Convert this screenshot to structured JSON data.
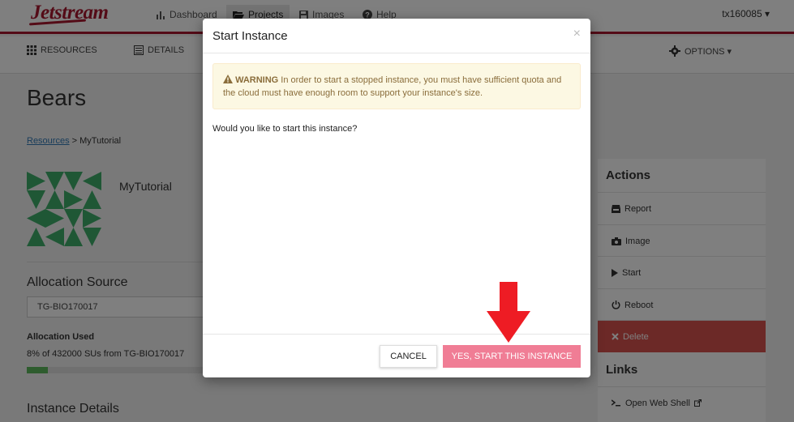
{
  "topnav": {
    "logo": "Jetstream",
    "items": [
      {
        "label": "Dashboard",
        "icon": "bar-chart-icon"
      },
      {
        "label": "Projects",
        "icon": "folder-open-icon"
      },
      {
        "label": "Images",
        "icon": "floppy-disk-icon"
      },
      {
        "label": "Help",
        "icon": "question-circle-icon"
      }
    ],
    "user": "tx160085 ▾"
  },
  "subnav": {
    "resources": "RESOURCES",
    "details": "DETAILS",
    "options": "OPTIONS ▾"
  },
  "page": {
    "title": "Bears",
    "breadcrumb_link": "Resources",
    "breadcrumb_sep": ">",
    "breadcrumb_current": "MyTutorial",
    "instance_name": "MyTutorial"
  },
  "allocation": {
    "heading": "Allocation Source",
    "selected": "TG-BIO170017",
    "used_heading": "Allocation Used",
    "used_value": "8% of 432000 SUs from TG-BIO170017",
    "used_fraction": 0.11
  },
  "instance_details_heading": "Instance Details",
  "actions": {
    "heading": "Actions",
    "items": [
      {
        "label": "Report",
        "icon": "inbox-icon"
      },
      {
        "label": "Image",
        "icon": "camera-icon"
      },
      {
        "label": "Start",
        "icon": "play-icon"
      },
      {
        "label": "Reboot",
        "icon": "power-icon"
      },
      {
        "label": "Delete",
        "icon": "close-icon"
      }
    ]
  },
  "links": {
    "heading": "Links",
    "items": [
      {
        "label": "Open Web Shell",
        "icon": "terminal-icon"
      }
    ]
  },
  "modal": {
    "title": "Start Instance",
    "close": "×",
    "warning_label": "WARNING",
    "warning_text": "In order to start a stopped instance, you must have sufficient quota and the cloud must have enough room to support your instance's size.",
    "question": "Would you like to start this instance?",
    "cancel_label": "CANCEL",
    "confirm_label": "YES, START THIS INSTANCE"
  },
  "colors": {
    "brand": "#a8172e",
    "primary_button": "#f07d95",
    "danger": "#d9534f",
    "identicon": "#3fae6b",
    "arrow": "#ee1c24"
  }
}
